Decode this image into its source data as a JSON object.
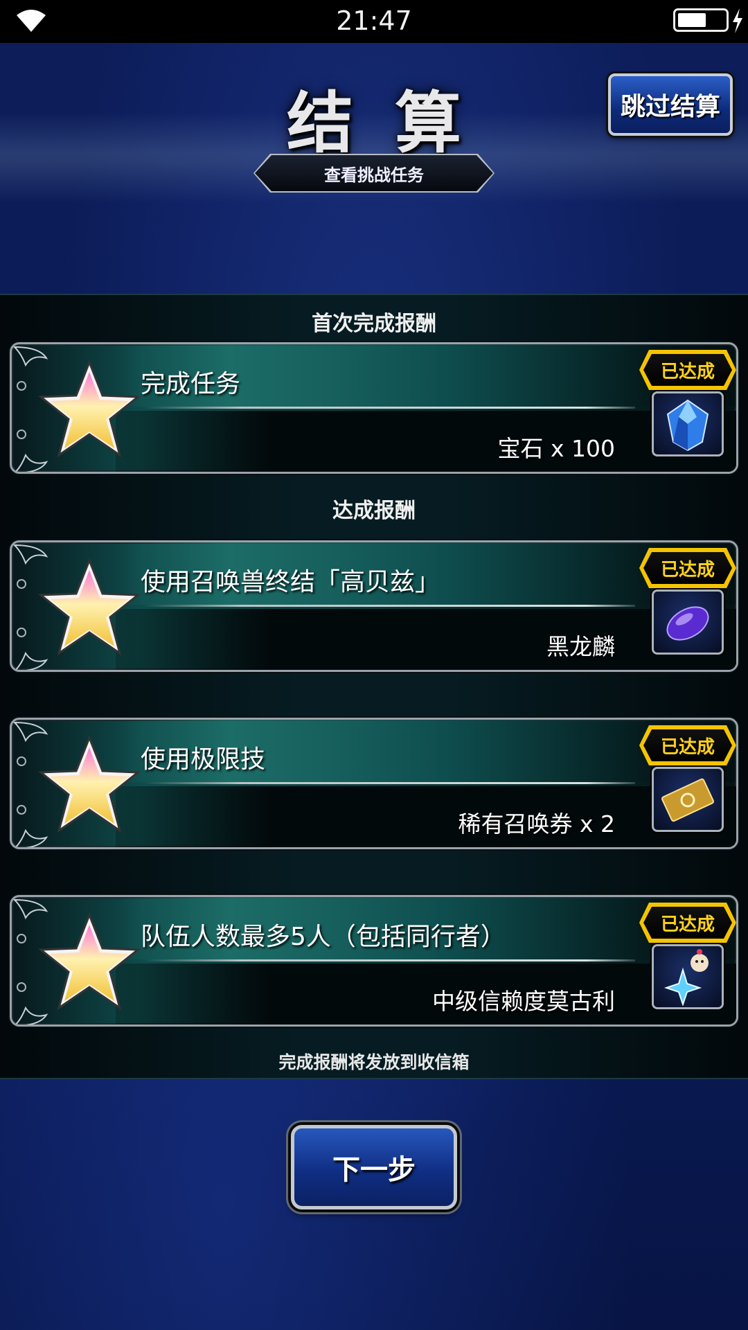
{
  "status_bar": {
    "time": "21:47"
  },
  "header": {
    "title": "结算",
    "skip_button": "跳过结算",
    "challenge_tab": "查看挑战任务"
  },
  "sections": {
    "first_clear_label": "首次完成报酬",
    "achievement_label": "达成报酬",
    "footer_note": "完成报酬将发放到收信箱"
  },
  "missions": [
    {
      "title": "完成任务",
      "reward": "宝石 x 100",
      "status": "已达成",
      "reward_icon": "gem-icon"
    },
    {
      "title": "使用召唤兽终结「高贝兹」",
      "reward": "黑龙麟",
      "status": "已达成",
      "reward_icon": "dragon-scale-icon"
    },
    {
      "title": "使用极限技",
      "reward": "稀有召唤券 x 2",
      "status": "已达成",
      "reward_icon": "summon-ticket-icon"
    },
    {
      "title": "队伍人数最多5人（包括同行者）",
      "reward": "中级信赖度莫古利",
      "status": "已达成",
      "reward_icon": "moogle-icon"
    }
  ],
  "next_button": "下一步",
  "colors": {
    "achieved": "#f5c400",
    "button_blue": "#1b45a8",
    "card_teal": "#0f4b4b"
  }
}
